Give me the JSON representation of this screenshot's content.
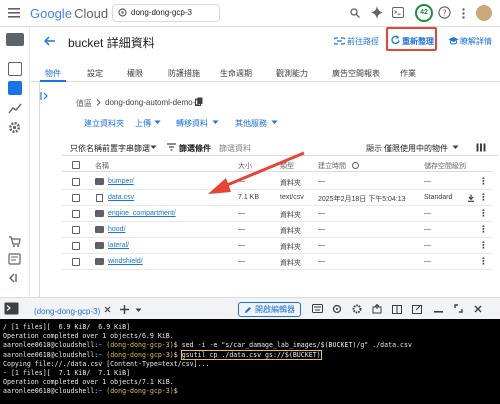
{
  "topbar": {
    "brand_google": "Google",
    "brand_cloud": "Cloud",
    "project": "dong-dong-gcp-3",
    "credits": "42"
  },
  "header": {
    "title": "bucket 詳細資料",
    "goto_path": "前往路徑",
    "refresh": "重新整理",
    "learn": "瞭解詳情"
  },
  "tabs": [
    "物件",
    "設定",
    "權限",
    "防護措施",
    "生命週期",
    "觀測能力",
    "廣告空間報表",
    "作業"
  ],
  "breadcrumb": {
    "root": "值區",
    "bucket": "dong-dong-automl-demo-1"
  },
  "actions": {
    "create_folder": "建立資料夾",
    "upload": "上傳",
    "transfer": "轉移資料",
    "more": "其他服務"
  },
  "filter": {
    "prefix": "只依名稱前置字串篩選",
    "filter_label": "篩選條件",
    "filter_placeholder": "篩選資料",
    "show_label": "顯示",
    "show_value": "僅限使用中的物件"
  },
  "table": {
    "headers": [
      "名稱",
      "大小",
      "類型",
      "建立時間",
      "儲存空間級別"
    ],
    "rows": [
      {
        "name": "bumper/",
        "size": "—",
        "type": "資料夾",
        "created": "—",
        "storage": "—",
        "kind": "folder"
      },
      {
        "name": "data.csv",
        "size": "7.1 KB",
        "type": "text/csv",
        "created": "2025年2月18日 下午5:04:13",
        "storage": "Standard",
        "kind": "file"
      },
      {
        "name": "engine_compartment/",
        "size": "—",
        "type": "資料夾",
        "created": "—",
        "storage": "—",
        "kind": "folder"
      },
      {
        "name": "hood/",
        "size": "—",
        "type": "資料夾",
        "created": "—",
        "storage": "—",
        "kind": "folder"
      },
      {
        "name": "lateral/",
        "size": "—",
        "type": "資料夾",
        "created": "—",
        "storage": "—",
        "kind": "folder"
      },
      {
        "name": "windshield/",
        "size": "—",
        "type": "資料夾",
        "created": "—",
        "storage": "—",
        "kind": "folder"
      }
    ]
  },
  "shell": {
    "tab_label": "(dong-dong-gcp-3)",
    "open_editor": "開啟編輯器",
    "lines": [
      {
        "type": "out",
        "text": "/ [1 files][  6.9 KiB/  6.9 KiB]"
      },
      {
        "type": "out",
        "text": "Operation completed over 1 objects/6.9 KiB."
      },
      {
        "type": "cmd",
        "user": "aaronlee0618@cloudshell:",
        "path": "~",
        "proj": "(dong-dong-gcp-3)",
        "cmd": "$ sed -i -e \"s/car_damage_lab_images/$(BUCKET)/g\" ./data.csv",
        "box": false
      },
      {
        "type": "cmd",
        "user": "aaronlee0618@cloudshell:",
        "path": "~",
        "proj": "(dong-dong-gcp-3)",
        "cmd": "$ gsutil cp ./data.csv gs://$(BUCKET)",
        "box": true
      },
      {
        "type": "out",
        "text": "Copying file://./data.csv [Content-Type=text/csv]..."
      },
      {
        "type": "out",
        "text": "- [1 files][  7.1 KiB/  7.1 KiB]"
      },
      {
        "type": "out",
        "text": "Operation completed over 1 objects/7.1 KiB."
      },
      {
        "type": "cmd",
        "user": "aaronlee0618@cloudshell:",
        "path": "~",
        "proj": "(dong-dong-gcp-3)",
        "cmd": "$ ",
        "box": false
      }
    ]
  },
  "colors": {
    "accent": "#1a73e8",
    "highlight": "#ea4335",
    "cmd_box": "#f4c430"
  }
}
